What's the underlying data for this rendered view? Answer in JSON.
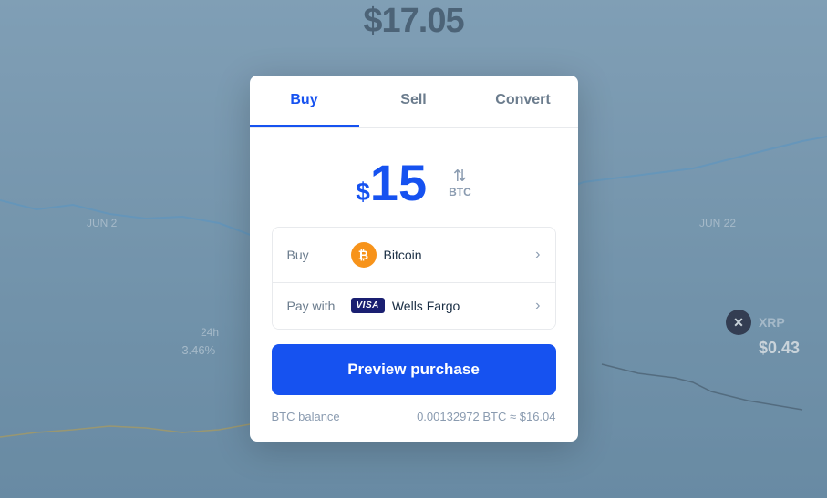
{
  "background": {
    "price_display": "$17.05",
    "date_labels": [
      "JUN 2",
      "JUN 22"
    ],
    "pct_change": "-3.46%",
    "label_24h": "24h"
  },
  "xrp": {
    "symbol": "XRP",
    "icon_letter": "✕",
    "price": "$0.43"
  },
  "modal": {
    "tabs": [
      {
        "id": "buy",
        "label": "Buy",
        "active": true
      },
      {
        "id": "sell",
        "label": "Sell",
        "active": false
      },
      {
        "id": "convert",
        "label": "Convert",
        "active": false
      }
    ],
    "amount": {
      "currency_symbol": "$",
      "value": "15",
      "toggle_arrows": "⇅",
      "toggle_label": "BTC"
    },
    "options": [
      {
        "label": "Buy",
        "asset_name": "Bitcoin",
        "icon_letter": "₿"
      },
      {
        "label": "Pay with",
        "payment_name": "Wells Fargo",
        "visa_text": "VISA"
      }
    ],
    "preview_button": "Preview purchase",
    "balance": {
      "label": "BTC balance",
      "value": "0.00132972 BTC  ≈ $16.04"
    }
  }
}
